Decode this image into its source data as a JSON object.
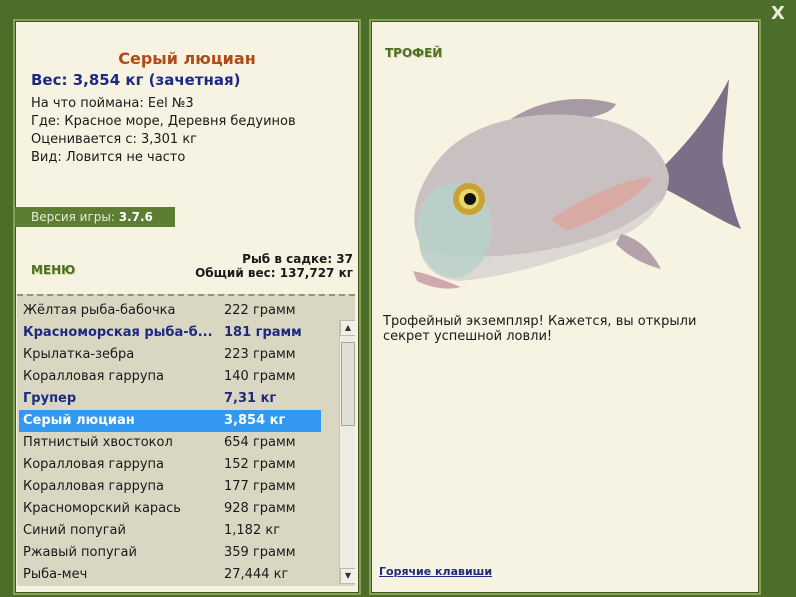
{
  "close_label": "X",
  "fish": {
    "title": "Серый люциан",
    "weight_line": "Вес: 3,854 кг (зачетная)",
    "caught_with": "На что поймана: Eel №3",
    "location": "Где: Красное море, Деревня бедуинов",
    "estimated_from": "Оценивается с: 3,301 кг",
    "species": "Вид: Ловится не часто"
  },
  "version": {
    "label": "Версия игры:",
    "value": "3.7.6"
  },
  "menu_label": "МЕНЮ",
  "stats": {
    "fish_count": "Рыб в садке: 37",
    "total_weight": "Общий вес: 137,727 кг"
  },
  "catch_list": [
    {
      "name": "Жёлтая рыба-бабочка",
      "weight": "222 грамм",
      "style": "normal"
    },
    {
      "name": "Красноморская рыба-б...",
      "weight": "181 грамм",
      "style": "bold"
    },
    {
      "name": "Крылатка-зебра",
      "weight": "223 грамм",
      "style": "normal"
    },
    {
      "name": "Коралловая гаррупа",
      "weight": "140 грамм",
      "style": "normal"
    },
    {
      "name": "Групер",
      "weight": "7,31 кг",
      "style": "bold"
    },
    {
      "name": "Серый люциан",
      "weight": "3,854 кг",
      "style": "selected"
    },
    {
      "name": "Пятнистый хвостокол",
      "weight": "654 грамм",
      "style": "normal"
    },
    {
      "name": "Коралловая гаррупа",
      "weight": "152 грамм",
      "style": "normal"
    },
    {
      "name": "Коралловая гаррупа",
      "weight": "177 грамм",
      "style": "normal"
    },
    {
      "name": "Красноморский карась",
      "weight": "928 грамм",
      "style": "normal"
    },
    {
      "name": "Синий попугай",
      "weight": "1,182 кг",
      "style": "normal"
    },
    {
      "name": "Ржавый попугай",
      "weight": "359 грамм",
      "style": "normal"
    },
    {
      "name": "Рыба-меч",
      "weight": "27,444 кг",
      "style": "normal"
    }
  ],
  "scroll_up_icon": "arrow-up-icon",
  "scroll_down_icon": "arrow-down-icon",
  "trophy": {
    "label": "ТРОФЕЙ",
    "text": "Трофейный экземпляр! Кажется, вы открыли секрет успешной ловли!"
  },
  "hotkeys_label": "Горячие клавиши"
}
